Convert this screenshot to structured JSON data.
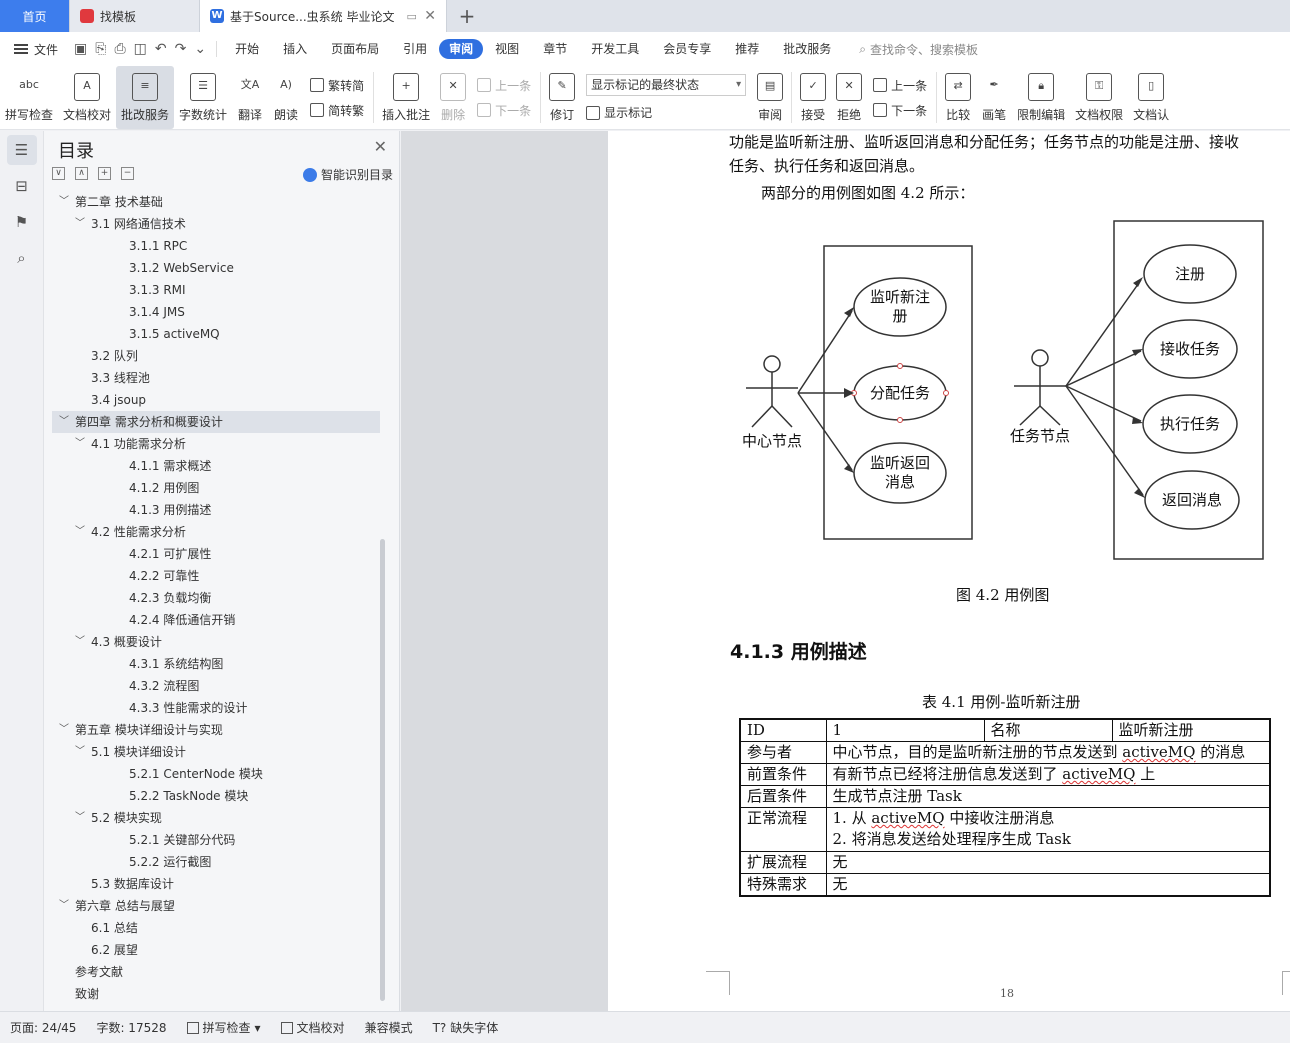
{
  "tabs": [
    {
      "label": "首页"
    },
    {
      "label": "找模板"
    },
    {
      "label": "基于Source...虫系统 毕业论文"
    }
  ],
  "menubar": {
    "file": "文件",
    "items": [
      "开始",
      "插入",
      "页面布局",
      "引用",
      "审阅",
      "视图",
      "章节",
      "开发工具",
      "会员专享",
      "推荐",
      "批改服务"
    ],
    "active": "审阅",
    "search": "查找命令、搜索模板"
  },
  "ribbon": {
    "spell": "拼写检查",
    "proof": "文档校对",
    "revise_service": "批改服务",
    "word_count": "字数统计",
    "translate": "翻译",
    "read": "朗读",
    "trad": "繁转简",
    "simp": "简转繁",
    "insert_comment": "插入批注",
    "delete": "删除",
    "prev": "上一条",
    "next": "下一条",
    "track": "修订",
    "markup_state": "显示标记的最终状态",
    "show_markup": "显示标记",
    "review": "审阅",
    "accept": "接受",
    "reject": "拒绝",
    "prev2": "上一条",
    "next2": "下一条",
    "compare": "比较",
    "pen": "画笔",
    "restrict": "限制编辑",
    "permission": "文档权限",
    "doc_more": "文档认"
  },
  "toc": {
    "title": "目录",
    "ai": "智能识别目录",
    "items": [
      {
        "text": "第二章  技术基础",
        "level": 1,
        "arrow": "﹀"
      },
      {
        "text": "3.1  网络通信技术",
        "level": 2,
        "arrow": "﹀"
      },
      {
        "text": "3.1.1 RPC",
        "level": 3
      },
      {
        "text": "3.1.2 WebService",
        "level": 3
      },
      {
        "text": "3.1.3 RMI",
        "level": 3
      },
      {
        "text": "3.1.4 JMS",
        "level": 3
      },
      {
        "text": "3.1.5 activeMQ",
        "level": 3
      },
      {
        "text": "3.2  队列",
        "level": 2
      },
      {
        "text": "3.3  线程池",
        "level": 2
      },
      {
        "text": "3.4 jsoup",
        "level": 2
      },
      {
        "text": "第四章  需求分析和概要设计",
        "level": 1,
        "arrow": "﹀",
        "sel": true
      },
      {
        "text": "4.1  功能需求分析",
        "level": 2,
        "arrow": "﹀"
      },
      {
        "text": "4.1.1  需求概述",
        "level": 3
      },
      {
        "text": "4.1.2  用例图",
        "level": 3
      },
      {
        "text": "4.1.3  用例描述",
        "level": 3
      },
      {
        "text": "4.2  性能需求分析",
        "level": 2,
        "arrow": "﹀"
      },
      {
        "text": "4.2.1  可扩展性",
        "level": 3
      },
      {
        "text": "4.2.2  可靠性",
        "level": 3
      },
      {
        "text": "4.2.3  负载均衡",
        "level": 3
      },
      {
        "text": "4.2.4  降低通信开销",
        "level": 3
      },
      {
        "text": "4.3  概要设计",
        "level": 2,
        "arrow": "﹀"
      },
      {
        "text": "4.3.1  系统结构图",
        "level": 3
      },
      {
        "text": "4.3.2  流程图",
        "level": 3
      },
      {
        "text": "4.3.3  性能需求的设计",
        "level": 3
      },
      {
        "text": "第五章  模块详细设计与实现",
        "level": 1,
        "arrow": "﹀"
      },
      {
        "text": "5.1  模块详细设计",
        "level": 2,
        "arrow": "﹀"
      },
      {
        "text": "5.2.1 CenterNode 模块",
        "level": 3
      },
      {
        "text": "5.2.2 TaskNode 模块",
        "level": 3
      },
      {
        "text": "5.2  模块实现",
        "level": 2,
        "arrow": "﹀"
      },
      {
        "text": "5.2.1  关键部分代码",
        "level": 3
      },
      {
        "text": "5.2.2  运行截图",
        "level": 3
      },
      {
        "text": "5.3  数据库设计",
        "level": 2
      },
      {
        "text": "第六章  总结与展望",
        "level": 1,
        "arrow": "﹀"
      },
      {
        "text": "6.1  总结",
        "level": 2
      },
      {
        "text": "6.2  展望",
        "level": 2
      },
      {
        "text": "参考文献",
        "level": 1
      },
      {
        "text": "致谢",
        "level": 1
      }
    ]
  },
  "document": {
    "line1": "功能是监听新注册、监听返回消息和分配任务；任务节点的功能是注册、接收",
    "line2": "任务、执行任务和返回消息。",
    "line3": "两部分的用例图如图 4.2 所示：",
    "diagram": {
      "actor_left": "中心节点",
      "left_cases": [
        "监听新注",
        "册",
        "分配任务",
        "监听返回",
        "消息"
      ],
      "actor_right": "任务节点",
      "right_cases": [
        "注册",
        "接收任务",
        "执行任务",
        "返回消息"
      ]
    },
    "figure_caption": "图 4.2  用例图",
    "section_heading": "4.1.3  用例描述",
    "table_caption": "表 4.1  用例-监听新注册",
    "table": {
      "r0": {
        "c0": "ID",
        "c1": "1",
        "c2": "名称",
        "c3": "监听新注册"
      },
      "rows": [
        {
          "label": "参与者",
          "value_a": "中心节点，目的是监听新注册的节点发送到 ",
          "wavy": "activeMQ",
          "value_b": " 的消息"
        },
        {
          "label": "前置条件",
          "value_a": "有新节点已经将注册信息发送到了 ",
          "wavy": "activeMQ",
          "value_b": " 上"
        },
        {
          "label": "后置条件",
          "value_a": "生成节点注册 Task",
          "wavy": "",
          "value_b": ""
        },
        {
          "label": "正常流程",
          "value_a": "1.  从 ",
          "wavy": "activeMQ",
          "value_b": " 中接收注册消息",
          "value_c": "2.  将消息发送给处理程序生成 Task"
        },
        {
          "label": "扩展流程",
          "value_a": "无",
          "wavy": "",
          "value_b": ""
        },
        {
          "label": "特殊需求",
          "value_a": "无",
          "wavy": "",
          "value_b": ""
        }
      ]
    },
    "page_number": "18"
  },
  "status": {
    "page": "页面: 24/45",
    "words": "字数: 17528",
    "spell": "拼写检查",
    "proof": "文档校对",
    "compat": "兼容模式",
    "missing_font": "缺失字体"
  }
}
